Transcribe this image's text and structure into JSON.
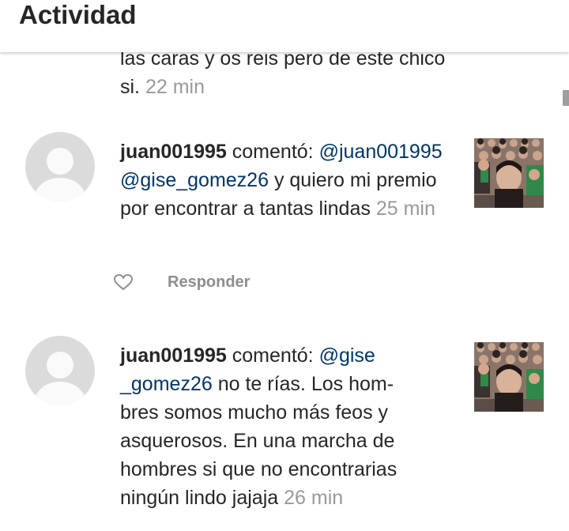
{
  "header": {
    "title": "Actividad"
  },
  "partial_comment": {
    "text": "las caras y os reis pero de este chico si.",
    "time": "22 min"
  },
  "comments": [
    {
      "username": "juan001995",
      "verb": "comentó:",
      "mention_1": "@juan001995",
      "mention_2": "@gise_gomez26",
      "text": "y quiero mi premio por encontrar a tantas lindas",
      "time": "25 min",
      "reply_label": "Responder",
      "avatar_icon": "default-avatar-icon",
      "like_icon": "heart-outline-icon"
    },
    {
      "username": "juan001995",
      "verb": "comentó:",
      "mention_1a": "@gise",
      "mention_1b": "_gomez26",
      "text_1": "no te rías. Los hom-",
      "text_2": "bres somos mucho más feos y asquerosos. En una marcha de hombres si que no encontrarias ningún lindo jajaja",
      "time": "26 min",
      "avatar_icon": "default-avatar-icon"
    }
  ]
}
